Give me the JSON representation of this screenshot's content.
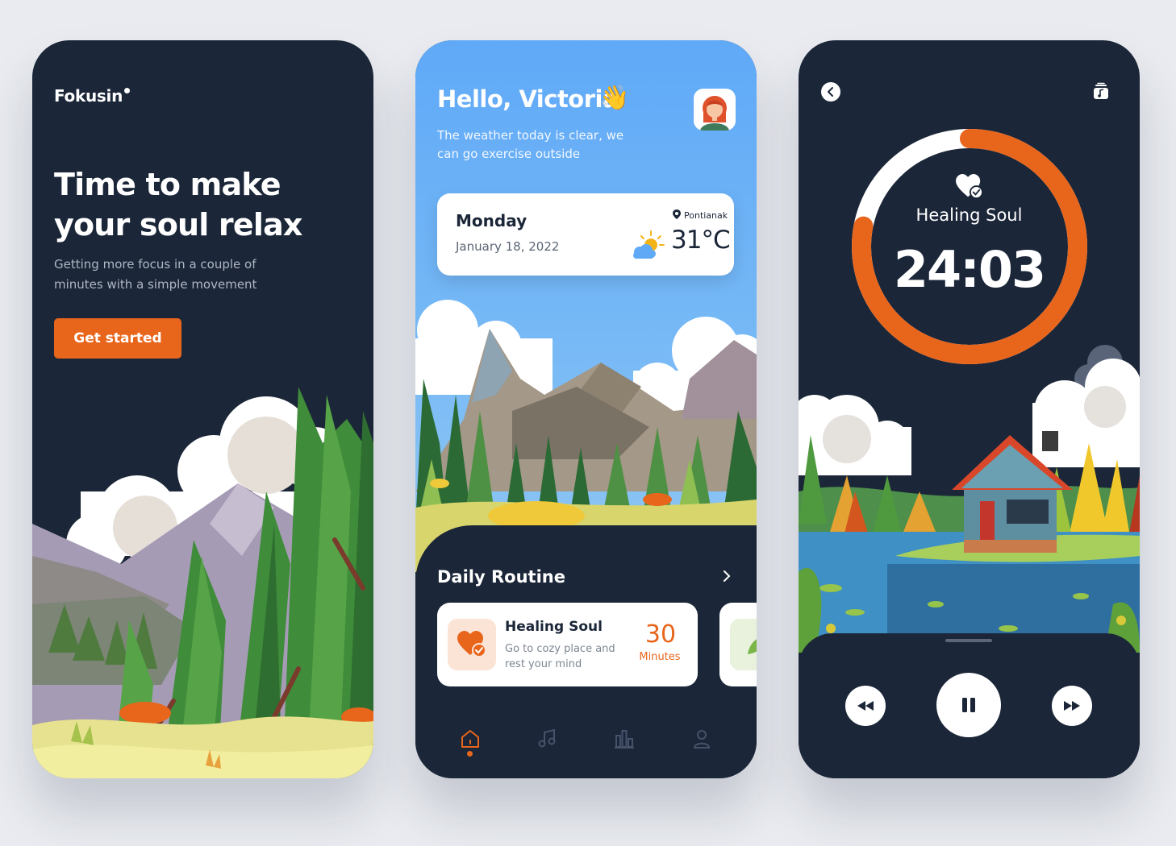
{
  "onboarding": {
    "brand": "Fokusin",
    "headline_line1": "Time to make",
    "headline_line2": "your soul relax",
    "subtitle_line1": "Getting more focus in a couple of",
    "subtitle_line2": "minutes with a simple movement",
    "cta_label": "Get started"
  },
  "home": {
    "greeting": "Hello, Victoria",
    "greeting_emoji": "👋",
    "weather_msg_line1": "The weather today is clear, we",
    "weather_msg_line2": "can go exercise outside",
    "weather_card": {
      "day": "Monday",
      "date": "January 18, 2022",
      "location": "Pontianak",
      "temperature": "31°C",
      "icon": "partly-sunny-icon"
    },
    "routine": {
      "title": "Daily Routine",
      "items": [
        {
          "title": "Healing Soul",
          "desc_line1": "Go to cozy place and",
          "desc_line2": "rest your mind",
          "duration": "30",
          "unit": "Minutes",
          "icon": "heart-check-icon"
        }
      ]
    },
    "nav": [
      "home-icon",
      "music-icon",
      "stats-icon",
      "profile-icon"
    ],
    "active_nav": "home-icon"
  },
  "player": {
    "track_title": "Healing Soul",
    "time_remaining": "24:03",
    "progress_fraction": 0.78,
    "icons": [
      "back-icon",
      "playlist-icon",
      "heart-check-icon",
      "rewind-icon",
      "pause-icon",
      "fast-forward-icon"
    ]
  },
  "colors": {
    "accent": "#e8661c",
    "dark": "#1b2638",
    "sky": "#5fa9f7"
  }
}
